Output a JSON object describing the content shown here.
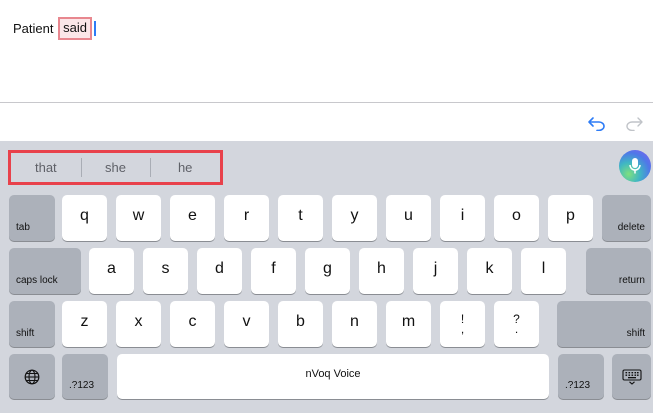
{
  "editor": {
    "text_before": "Patient ",
    "highlighted_word": "said"
  },
  "keyboard": {
    "suggestions": [
      "that",
      "she",
      "he"
    ],
    "row1": [
      "q",
      "w",
      "e",
      "r",
      "t",
      "y",
      "u",
      "i",
      "o",
      "p"
    ],
    "row2": [
      "a",
      "s",
      "d",
      "f",
      "g",
      "h",
      "j",
      "k",
      "l"
    ],
    "row3": [
      "z",
      "x",
      "c",
      "v",
      "b",
      "n",
      "m"
    ],
    "row3_punct": [
      {
        "top": "!",
        "bottom": ","
      },
      {
        "top": "?",
        "bottom": "."
      }
    ],
    "tab_label": "tab",
    "delete_label": "delete",
    "caps_label": "caps lock",
    "return_label": "return",
    "shift_label": "shift",
    "numbers_label": ".?123",
    "space_label": "nVoq Voice"
  },
  "colors": {
    "highlight_border": "#e8878f",
    "suggestion_outline": "#e8414b",
    "caret": "#2e7cf6",
    "accent_blue": "#2e7cf6"
  },
  "icons": {
    "undo": "undo-arrow-icon",
    "redo": "redo-arrow-icon",
    "mic": "microphone-icon",
    "globe": "globe-icon",
    "dismiss": "keyboard-dismiss-icon"
  }
}
